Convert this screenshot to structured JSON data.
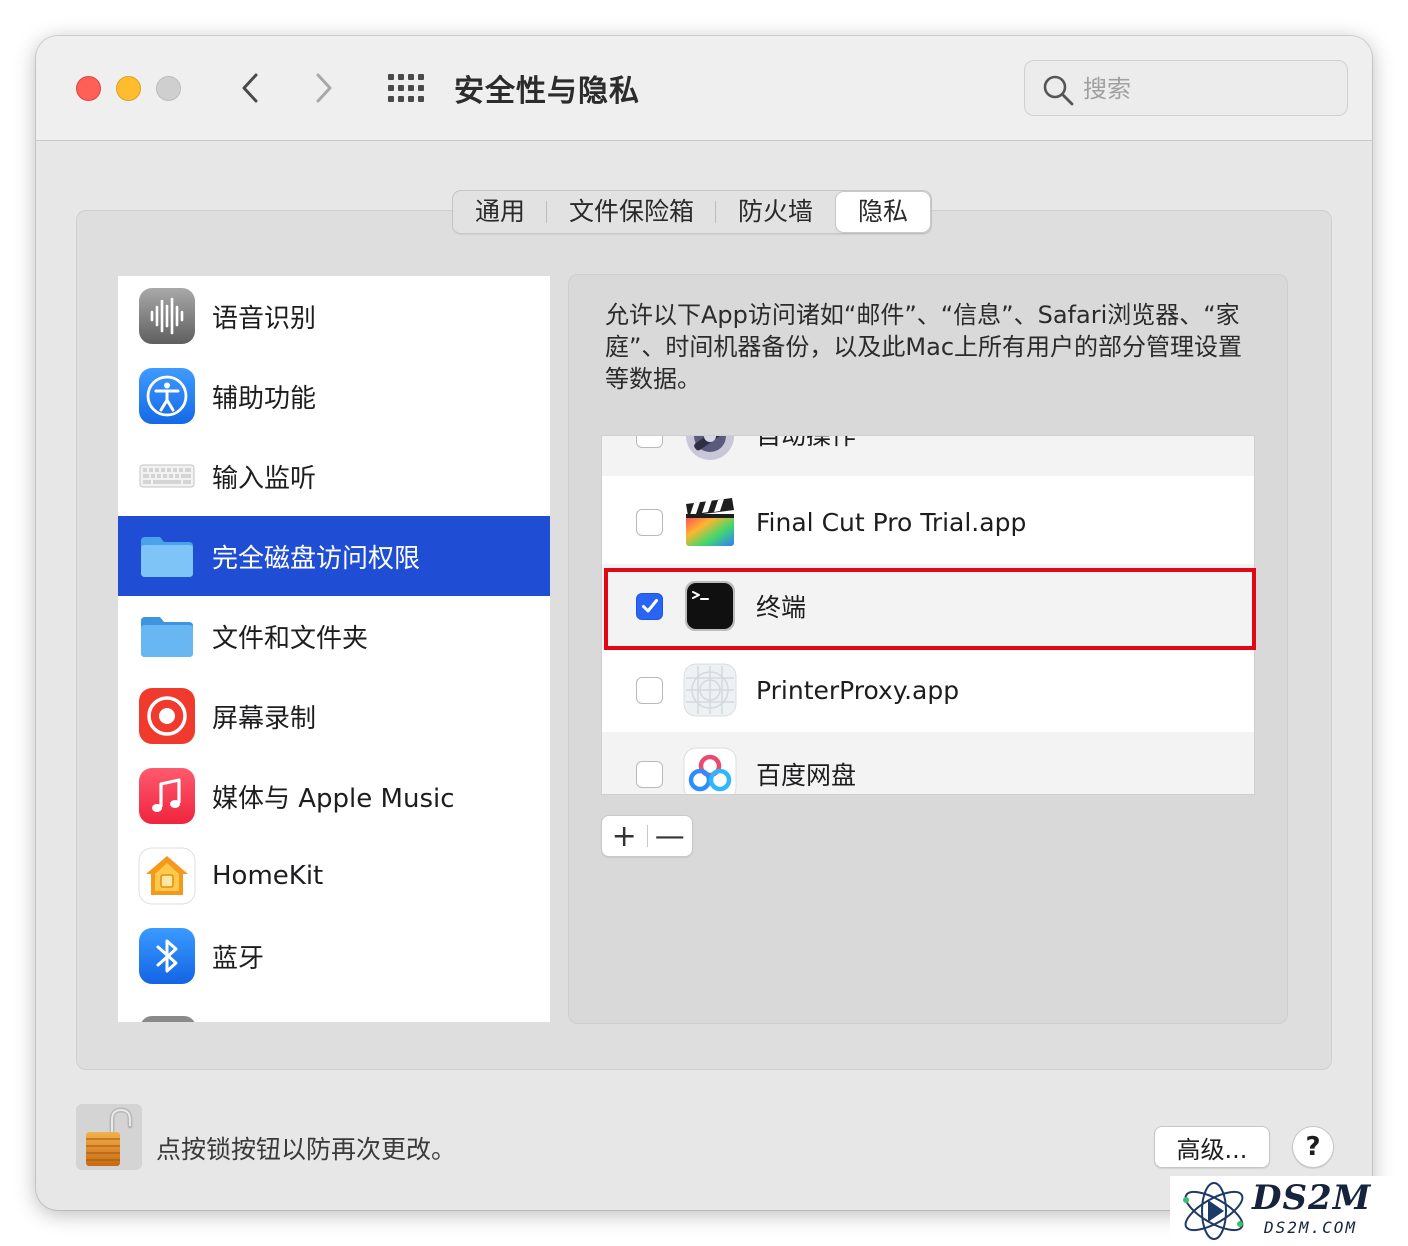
{
  "window": {
    "title": "安全性与隐私",
    "search_placeholder": "搜索"
  },
  "tabs": [
    {
      "label": "通用"
    },
    {
      "label": "文件保险箱"
    },
    {
      "label": "防火墙"
    },
    {
      "label": "隐私",
      "active": true
    }
  ],
  "sidebar": {
    "items": [
      {
        "label": "语音识别",
        "icon": "speech-recognition-icon"
      },
      {
        "label": "辅助功能",
        "icon": "accessibility-icon"
      },
      {
        "label": "输入监听",
        "icon": "keyboard-icon"
      },
      {
        "label": "完全磁盘访问权限",
        "icon": "folder-icon",
        "selected": true
      },
      {
        "label": "文件和文件夹",
        "icon": "folder-icon"
      },
      {
        "label": "屏幕录制",
        "icon": "screen-recording-icon"
      },
      {
        "label": "媒体与 Apple Music",
        "icon": "music-icon"
      },
      {
        "label": "HomeKit",
        "icon": "homekit-icon"
      },
      {
        "label": "蓝牙",
        "icon": "bluetooth-icon"
      }
    ]
  },
  "detail": {
    "description": "允许以下App访问诸如“邮件”、“信息”、Safari浏览器、“家庭”、时间机器备份，以及此Mac上所有用户的部分管理设置等数据。",
    "apps": [
      {
        "name": "自动操作",
        "checked": false,
        "icon": "automator-icon"
      },
      {
        "name": "Final Cut Pro Trial.app",
        "checked": false,
        "icon": "final-cut-pro-icon"
      },
      {
        "name": "终端",
        "checked": true,
        "icon": "terminal-icon"
      },
      {
        "name": "PrinterProxy.app",
        "checked": false,
        "icon": "printer-proxy-icon"
      },
      {
        "name": "百度网盘",
        "checked": false,
        "icon": "baidu-netdisk-icon"
      }
    ],
    "add_label": "+",
    "remove_label": "—"
  },
  "footer": {
    "lock_text": "点按锁按钮以防再次更改。",
    "advanced_label": "高级...",
    "help_label": "?"
  },
  "watermark": {
    "brand": "DS2M",
    "domain": "DS2M.COM"
  },
  "colors": {
    "selection": "#1f4ed4",
    "checkbox_checked": "#2a64f4",
    "highlight_box": "#e30613"
  }
}
